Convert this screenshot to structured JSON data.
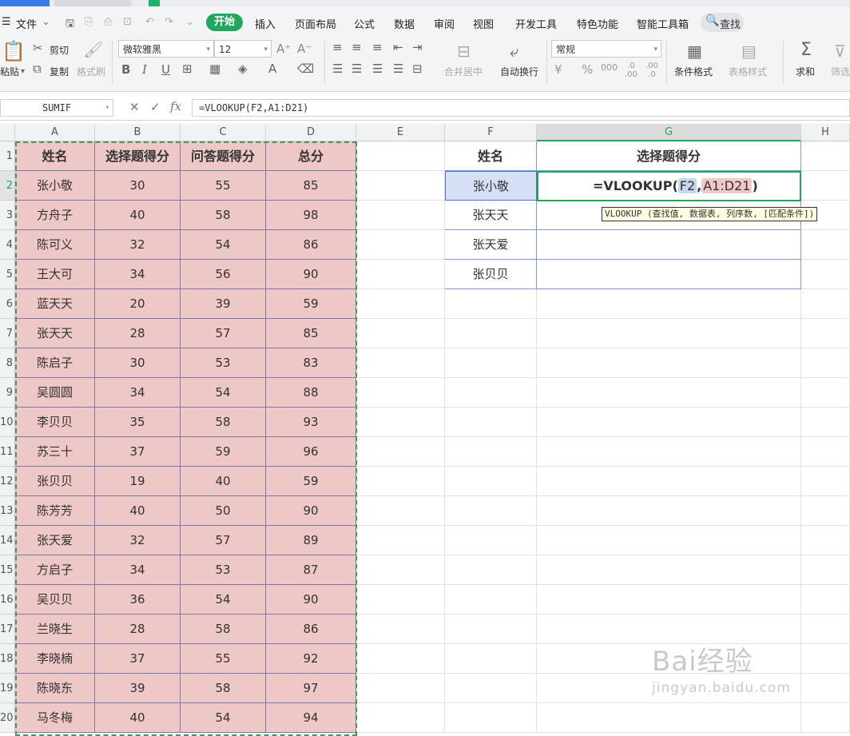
{
  "menu": {
    "file": "文件",
    "tabs": [
      "开始",
      "插入",
      "页面布局",
      "公式",
      "数据",
      "审阅",
      "视图",
      "开发工具",
      "特色功能",
      "智能工具箱"
    ],
    "search": "查找"
  },
  "ribbon": {
    "paste": "粘贴",
    "cut": "剪切",
    "copy": "复制",
    "format_painter": "格式刷",
    "font_name": "微软雅黑",
    "font_size": "12",
    "merge_center": "合并居中",
    "wrap_text": "自动换行",
    "number_format": "常规",
    "conditional_format": "条件格式",
    "table_style": "表格样式",
    "sum": "求和",
    "filter": "筛选",
    "bold": "B",
    "italic": "I",
    "underline": "U"
  },
  "formula_bar": {
    "name_box": "SUMIF",
    "fx": "fx",
    "formula": "=VLOOKUP(F2,A1:D21)"
  },
  "columns": [
    "A",
    "B",
    "C",
    "D",
    "E",
    "F",
    "G",
    "H"
  ],
  "row_numbers": [
    "1",
    "2",
    "3",
    "4",
    "5",
    "6",
    "7",
    "8",
    "9",
    "10",
    "11",
    "12",
    "13",
    "14",
    "15",
    "16",
    "17",
    "18",
    "19",
    "20"
  ],
  "table": {
    "headers": [
      "姓名",
      "选择题得分",
      "问答题得分",
      "总分"
    ],
    "rows": [
      [
        "张小敬",
        "30",
        "55",
        "85"
      ],
      [
        "方舟子",
        "40",
        "58",
        "98"
      ],
      [
        "陈可义",
        "32",
        "54",
        "86"
      ],
      [
        "王大可",
        "34",
        "56",
        "90"
      ],
      [
        "蓝天天",
        "20",
        "39",
        "59"
      ],
      [
        "张天天",
        "28",
        "57",
        "85"
      ],
      [
        "陈启子",
        "30",
        "53",
        "83"
      ],
      [
        "吴圆圆",
        "34",
        "54",
        "88"
      ],
      [
        "李贝贝",
        "35",
        "58",
        "93"
      ],
      [
        "苏三十",
        "37",
        "59",
        "96"
      ],
      [
        "张贝贝",
        "19",
        "40",
        "59"
      ],
      [
        "陈芳芳",
        "40",
        "50",
        "90"
      ],
      [
        "张天爱",
        "32",
        "57",
        "89"
      ],
      [
        "方启子",
        "34",
        "53",
        "87"
      ],
      [
        "吴贝贝",
        "36",
        "54",
        "90"
      ],
      [
        "兰晓生",
        "28",
        "58",
        "86"
      ],
      [
        "李晓楠",
        "37",
        "55",
        "92"
      ],
      [
        "陈晓东",
        "39",
        "58",
        "97"
      ],
      [
        "马冬梅",
        "40",
        "54",
        "94"
      ]
    ]
  },
  "lookup": {
    "headers": [
      "姓名",
      "选择题得分"
    ],
    "names": [
      "张小敬",
      "张天天",
      "张天爱",
      "张贝贝"
    ],
    "editing": {
      "prefix": "=VLOOKUP(",
      "ref1": "F2",
      "comma": ",",
      "ref2": "A1:D21",
      "suffix": ")"
    },
    "tooltip": "VLOOKUP (查找值, 数据表, 列序数, [匹配条件])"
  },
  "watermark": {
    "brand": "Bai经验",
    "url": "jingyan.baidu.com"
  }
}
